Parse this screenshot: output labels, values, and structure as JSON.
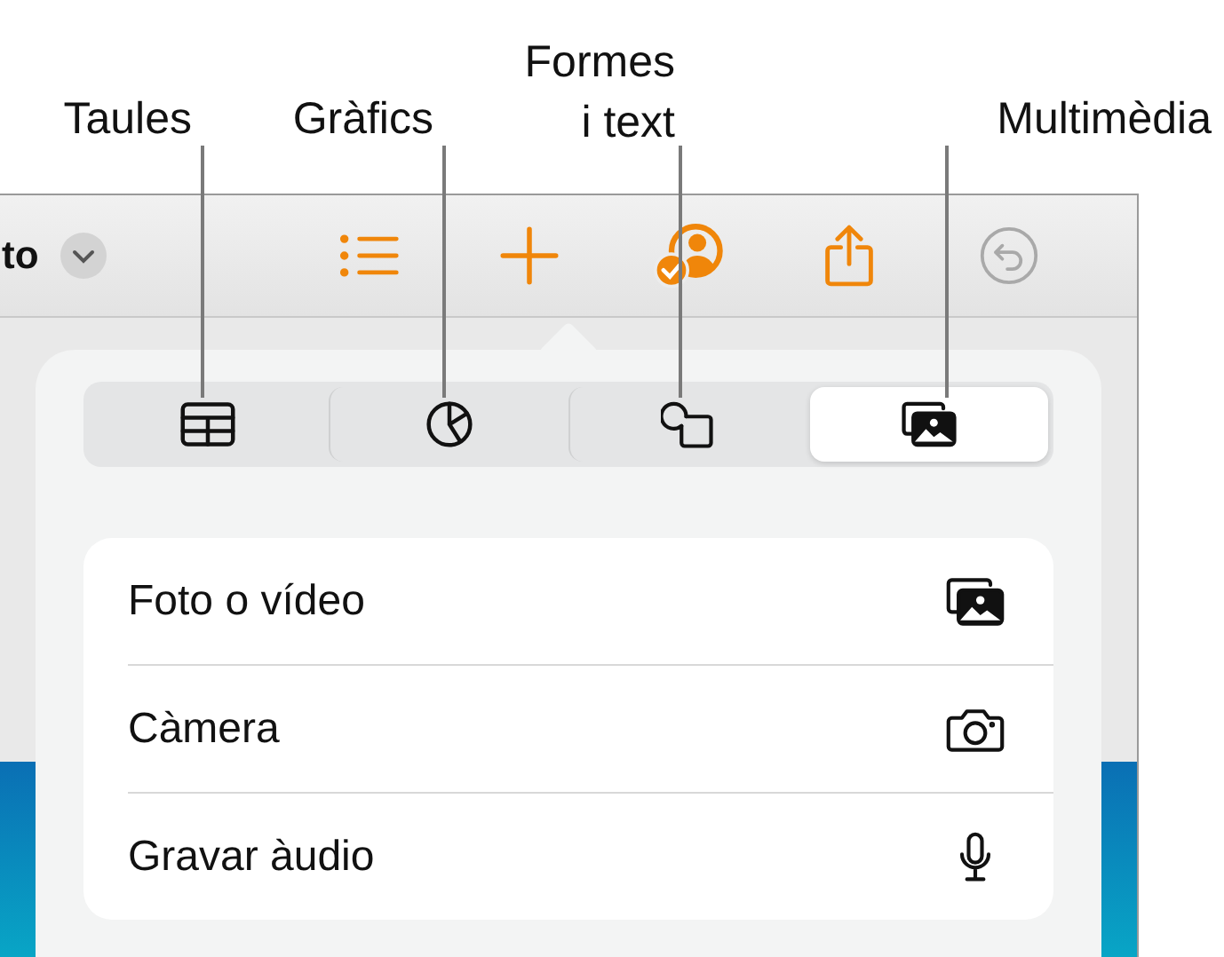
{
  "callouts": [
    {
      "label": "Taules",
      "kind": "table"
    },
    {
      "label": "Gràfics",
      "kind": "chart"
    },
    {
      "label": "Formes i text",
      "kind": "shapes"
    },
    {
      "label": "Multimèdia",
      "kind": "media"
    }
  ],
  "toolbar": {
    "title": "to",
    "buttons": [
      {
        "kind": "list",
        "disabled": false
      },
      {
        "kind": "add",
        "disabled": false
      },
      {
        "kind": "collaborate",
        "disabled": false
      },
      {
        "kind": "share",
        "disabled": false
      },
      {
        "kind": "undo",
        "disabled": true
      }
    ]
  },
  "popover": {
    "tabs": [
      {
        "kind": "table",
        "selected": false
      },
      {
        "kind": "chart",
        "selected": false
      },
      {
        "kind": "shapes",
        "selected": false
      },
      {
        "kind": "media",
        "selected": true
      }
    ],
    "items": [
      {
        "label": "Foto o vídeo",
        "kind": "photo"
      },
      {
        "label": "Càmera",
        "kind": "camera"
      },
      {
        "label": "Gravar àudio",
        "kind": "mic"
      }
    ]
  }
}
